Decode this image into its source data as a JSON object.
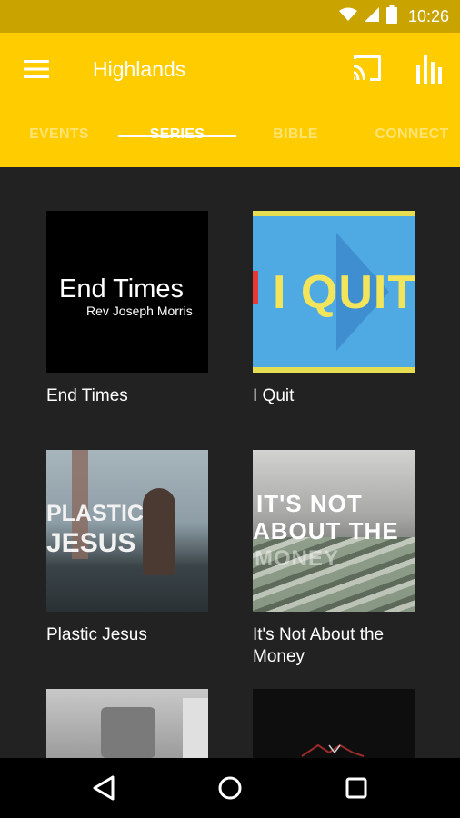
{
  "status_bar": {
    "time": "10:26"
  },
  "app_bar": {
    "title": "Highlands"
  },
  "tabs": [
    {
      "label": "EVENTS",
      "active": false
    },
    {
      "label": "SERIES",
      "active": true
    },
    {
      "label": "BIBLE",
      "active": false
    },
    {
      "label": "CONNECT",
      "active": false
    }
  ],
  "series": [
    {
      "title": "End Times",
      "thumb_line1": "End Times",
      "thumb_line2": "Rev Joseph Morris"
    },
    {
      "title": "I Quit",
      "thumb_text": "I QUIT"
    },
    {
      "title": "Plastic Jesus",
      "thumb_line1": "PLASTIC",
      "thumb_line2": "JESUS"
    },
    {
      "title": "It's Not About the Money",
      "thumb_line1": "IT'S NOT",
      "thumb_line2": "ABOUT THE",
      "thumb_line3": "MONEY"
    },
    {
      "title": "",
      "thumb_text": ""
    },
    {
      "title": "",
      "thumb_text": ""
    }
  ],
  "colors": {
    "status_bar": "#C9A300",
    "app_bar": "#FFCC00",
    "background": "#222222",
    "nav_bar": "#000000"
  }
}
